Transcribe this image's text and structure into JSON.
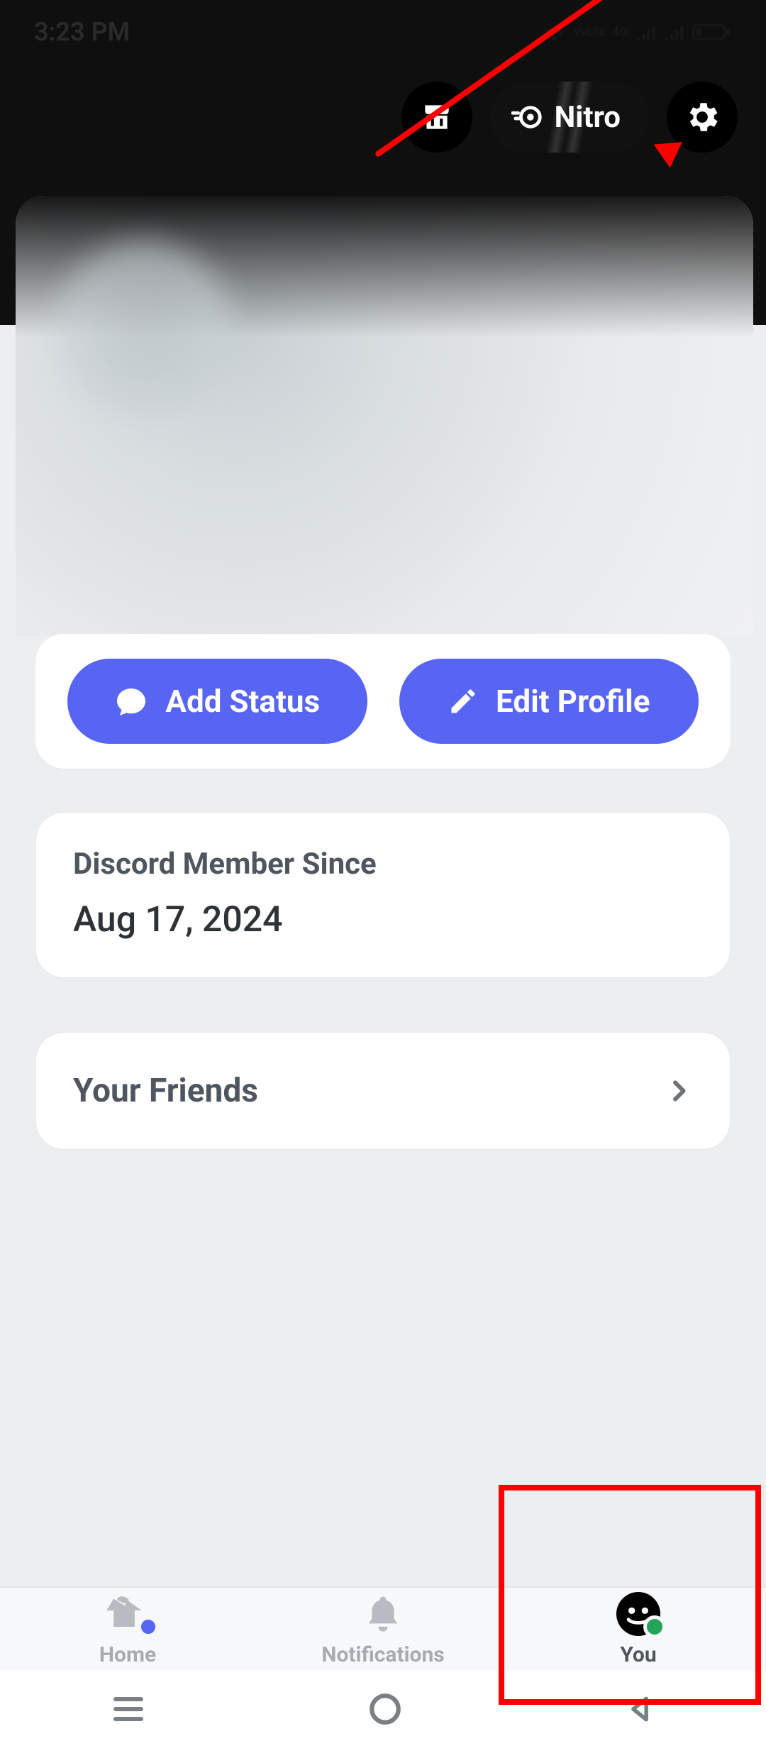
{
  "status": {
    "time": "3:23 PM",
    "network1": "VoLTE",
    "network2": "4G"
  },
  "top": {
    "nitro_label": "Nitro"
  },
  "actions": {
    "add_status": "Add Status",
    "edit_profile": "Edit Profile"
  },
  "member": {
    "label": "Discord Member Since",
    "value": "Aug 17, 2024"
  },
  "friends": {
    "label": "Your Friends"
  },
  "tabs": {
    "home": "Home",
    "notifications": "Notifications",
    "you": "You"
  }
}
